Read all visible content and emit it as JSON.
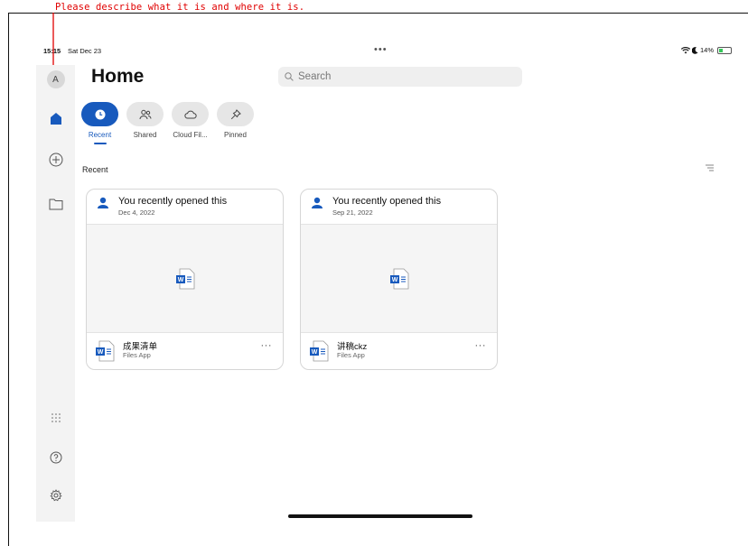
{
  "annotation": {
    "text": "Please describe what it is and where it is.",
    "color": "#e00000"
  },
  "status_bar": {
    "time": "15:15",
    "date": "Sat Dec 23",
    "more": "•••",
    "battery": "14%"
  },
  "sidebar": {
    "avatar_initial": "A",
    "accent": "#185abd"
  },
  "header": {
    "title": "Home",
    "search_placeholder": "Search"
  },
  "tabs": [
    {
      "label": "Recent",
      "active": true,
      "icon": "clock-icon"
    },
    {
      "label": "Shared",
      "active": false,
      "icon": "people-icon"
    },
    {
      "label": "Cloud Fil...",
      "active": false,
      "icon": "cloud-icon"
    },
    {
      "label": "Pinned",
      "active": false,
      "icon": "pin-icon"
    }
  ],
  "section": {
    "label": "Recent"
  },
  "cards": [
    {
      "activity": "You recently opened this",
      "date": "Dec 4, 2022",
      "file_name": "成果清单",
      "location": "Files App",
      "more": "···"
    },
    {
      "activity": "You recently opened this",
      "date": "Sep 21, 2022",
      "file_name": "讲稿ckz",
      "location": "Files App",
      "more": "···"
    }
  ]
}
